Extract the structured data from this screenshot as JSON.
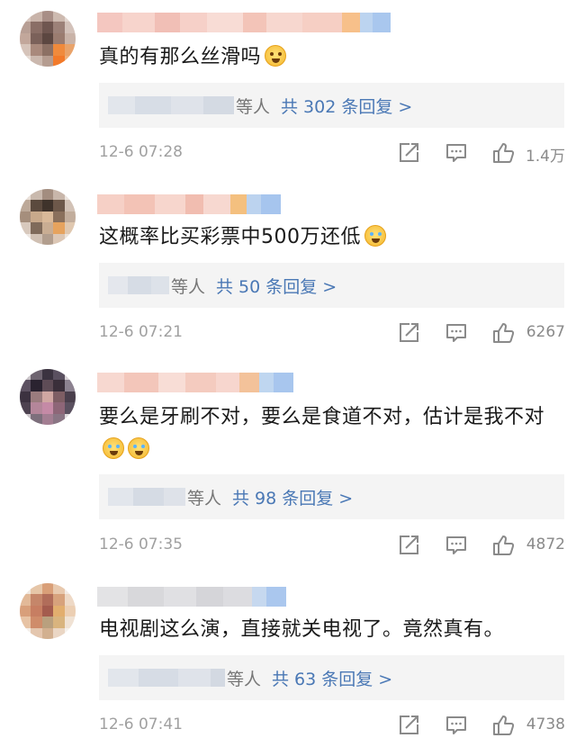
{
  "comments": [
    {
      "text": "真的有那么丝滑吗",
      "emoji": "flushed-emoji",
      "reply_prefix": "等人",
      "reply_link": "共 302 条回复 >",
      "date": "12-6 07:28",
      "likes": "1.4万"
    },
    {
      "text": "这概率比买彩票中500万还低",
      "emoji": "laughing-crying-emoji",
      "reply_prefix": "等人",
      "reply_link": "共 50 条回复 >",
      "date": "12-6 07:21",
      "likes": "6267"
    },
    {
      "text": "要么是牙刷不对，要么是食道不对，估计是我不对",
      "emoji": "laughing-crying-emoji",
      "reply_prefix": "等人",
      "reply_link": "共 98 条回复 >",
      "date": "12-6 07:35",
      "likes": "4872"
    },
    {
      "text": "电视剧这么演，直接就关电视了。竟然真有。",
      "reply_prefix": "等人",
      "reply_link": "共 63 条回复 >",
      "date": "12-6 07:41",
      "likes": "4738"
    }
  ],
  "icons": {
    "share": "share-icon",
    "comment": "comment-icon",
    "like": "thumbs-up-icon"
  },
  "colors": {
    "link": "#4a78b5",
    "meta": "#a0a0a0",
    "reply_bg": "#f4f4f4"
  }
}
